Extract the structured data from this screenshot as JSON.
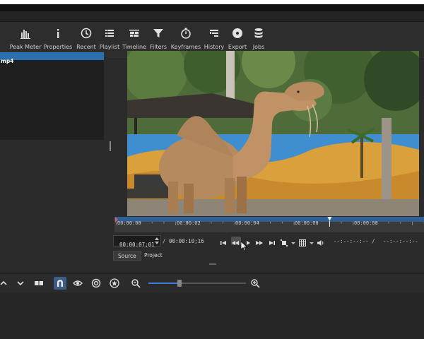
{
  "toolbar": {
    "items": [
      {
        "label": "Peak Meter",
        "icon": "peak-meter-icon"
      },
      {
        "label": "Properties",
        "icon": "info-icon"
      },
      {
        "label": "Recent",
        "icon": "clock-icon"
      },
      {
        "label": "Playlist",
        "icon": "list-icon"
      },
      {
        "label": "Timeline",
        "icon": "timeline-icon"
      },
      {
        "label": "Filters",
        "icon": "funnel-icon"
      },
      {
        "label": "Keyframes",
        "icon": "stopwatch-icon"
      },
      {
        "label": "History",
        "icon": "history-icon"
      },
      {
        "label": "Export",
        "icon": "disc-icon"
      },
      {
        "label": "Jobs",
        "icon": "database-icon"
      }
    ]
  },
  "left_panel": {
    "selected_item": "mp4"
  },
  "timeline_ruler": {
    "ticks": [
      "00:00:00",
      "00:00:02",
      "00:00:04",
      "00:00:06",
      "00:00:08"
    ],
    "playhead_fraction": 0.695
  },
  "transport": {
    "current_time": "00:00:07;01",
    "total_time": "/ 00:00:10;16",
    "in_point": "--:--:--:-- /",
    "out_point": "--:--:--:--"
  },
  "tabs": {
    "source": "Source",
    "project": "Project"
  },
  "zoom": {
    "level_fraction": 0.32
  },
  "colors": {
    "accent": "#2a6fb0",
    "background": "#2b2b2b"
  }
}
